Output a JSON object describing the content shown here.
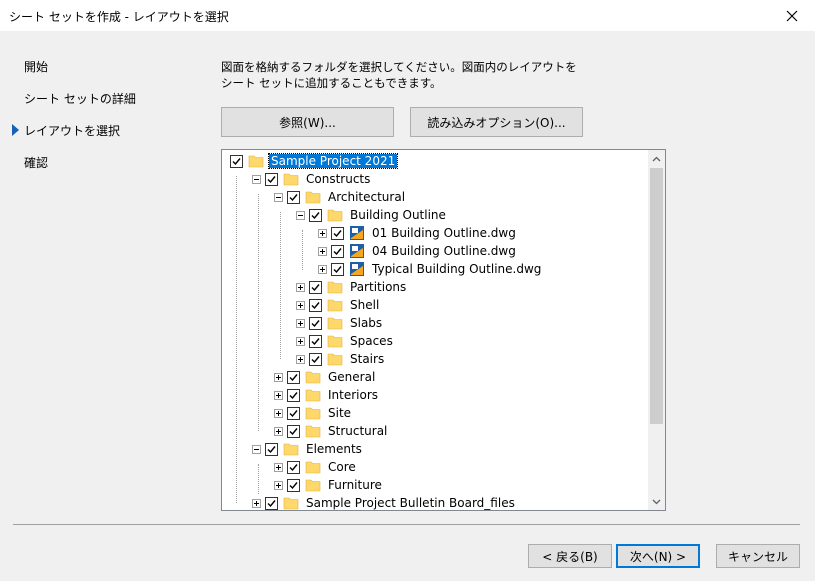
{
  "window": {
    "title": "シート セットを作成 - レイアウトを選択"
  },
  "nav": {
    "items": [
      {
        "label": "開始"
      },
      {
        "label": "シート セットの詳細"
      },
      {
        "label": "レイアウトを選択",
        "current": true
      },
      {
        "label": "確認"
      }
    ]
  },
  "description": {
    "line1": "図面を格納するフォルダを選択してください。図面内のレイアウトを",
    "line2": "シート セットに追加することもできます。"
  },
  "buttons": {
    "browse": "参照(W)...",
    "import_options": "読み込みオプション(O)..."
  },
  "tree": {
    "nodes": [
      {
        "label": "Sample Project 2021",
        "level": 0,
        "type": "folder",
        "checked": true,
        "expander": "none",
        "selected": true
      },
      {
        "label": "Constructs",
        "level": 1,
        "type": "folder",
        "checked": true,
        "expander": "minus"
      },
      {
        "label": "Architectural",
        "level": 2,
        "type": "folder",
        "checked": true,
        "expander": "minus"
      },
      {
        "label": "Building Outline",
        "level": 3,
        "type": "folder",
        "checked": true,
        "expander": "minus"
      },
      {
        "label": "01 Building Outline.dwg",
        "level": 4,
        "type": "dwg",
        "checked": true,
        "expander": "plus"
      },
      {
        "label": "04 Building Outline.dwg",
        "level": 4,
        "type": "dwg",
        "checked": true,
        "expander": "plus"
      },
      {
        "label": "Typical Building Outline.dwg",
        "level": 4,
        "type": "dwg",
        "checked": true,
        "expander": "plus"
      },
      {
        "label": "Partitions",
        "level": 3,
        "type": "folder",
        "checked": true,
        "expander": "plus"
      },
      {
        "label": "Shell",
        "level": 3,
        "type": "folder",
        "checked": true,
        "expander": "plus"
      },
      {
        "label": "Slabs",
        "level": 3,
        "type": "folder",
        "checked": true,
        "expander": "plus"
      },
      {
        "label": "Spaces",
        "level": 3,
        "type": "folder",
        "checked": true,
        "expander": "plus"
      },
      {
        "label": "Stairs",
        "level": 3,
        "type": "folder",
        "checked": true,
        "expander": "plus"
      },
      {
        "label": "General",
        "level": 2,
        "type": "folder",
        "checked": true,
        "expander": "plus"
      },
      {
        "label": "Interiors",
        "level": 2,
        "type": "folder",
        "checked": true,
        "expander": "plus"
      },
      {
        "label": "Site",
        "level": 2,
        "type": "folder",
        "checked": true,
        "expander": "plus"
      },
      {
        "label": "Structural",
        "level": 2,
        "type": "folder",
        "checked": true,
        "expander": "plus"
      },
      {
        "label": "Elements",
        "level": 1,
        "type": "folder",
        "checked": true,
        "expander": "minus"
      },
      {
        "label": "Core",
        "level": 2,
        "type": "folder",
        "checked": true,
        "expander": "plus"
      },
      {
        "label": "Furniture",
        "level": 2,
        "type": "folder",
        "checked": true,
        "expander": "plus"
      },
      {
        "label": "Sample Project Bulletin Board_files",
        "level": 1,
        "type": "folder",
        "checked": true,
        "expander": "plus"
      }
    ]
  },
  "footer": {
    "back": "< 戻る(B)",
    "next": "次へ(N) >",
    "cancel": "キャンセル"
  },
  "colors": {
    "accent": "#0078d7",
    "nav_arrow": "#1a5fb4",
    "folder": "#ffd86b",
    "dwg_blue": "#1e5fa8",
    "dwg_orange": "#f5a623"
  }
}
